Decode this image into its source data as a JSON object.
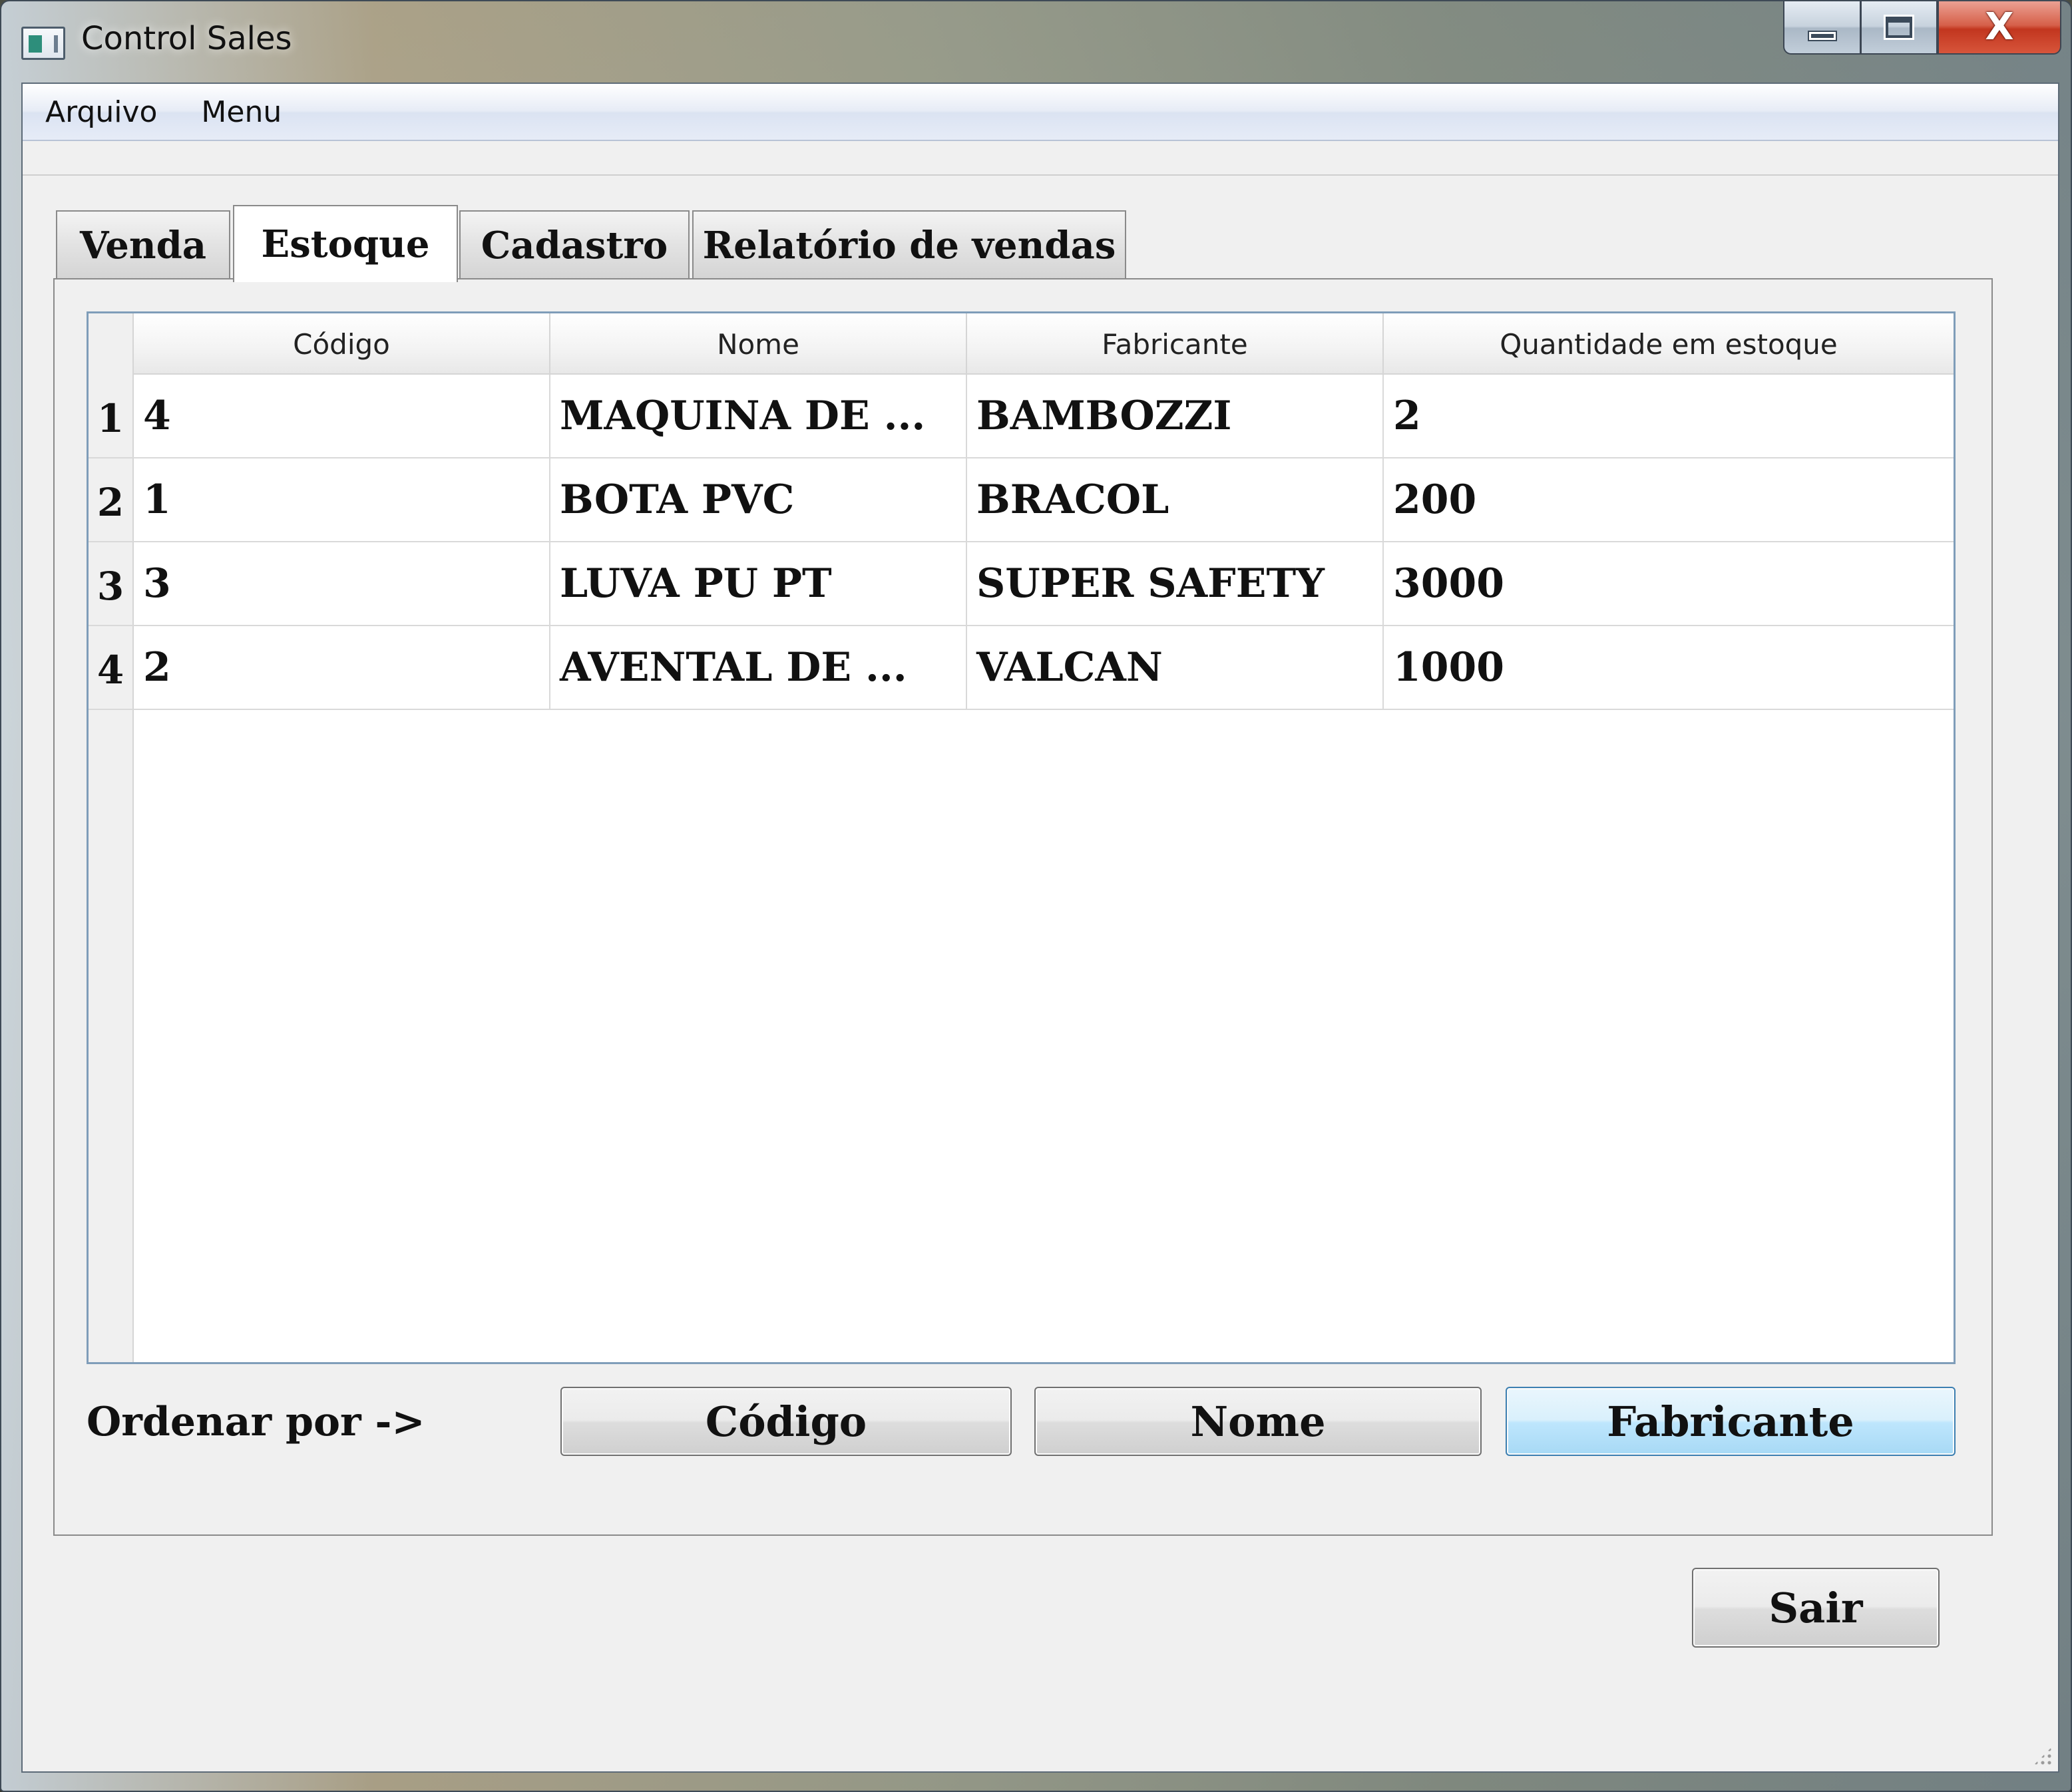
{
  "window": {
    "title": "Control Sales",
    "controls": {
      "minimize_icon": "minimize-icon",
      "maximize_icon": "restore-icon",
      "close_icon": "close-icon",
      "close_glyph": "X"
    }
  },
  "menubar": {
    "items": [
      {
        "label": "Arquivo"
      },
      {
        "label": "Menu"
      }
    ]
  },
  "tabs": [
    {
      "label": "Venda",
      "active": false
    },
    {
      "label": "Estoque",
      "active": true
    },
    {
      "label": "Cadastro",
      "active": false
    },
    {
      "label": "Relatório de vendas",
      "active": false
    }
  ],
  "grid": {
    "columns": [
      "Código",
      "Nome",
      "Fabricante",
      "Quantidade em estoque"
    ],
    "rows": [
      {
        "index": "1",
        "codigo": "4",
        "nome": "MAQUINA DE ...",
        "fabricante": "BAMBOZZI",
        "quantidade": "2"
      },
      {
        "index": "2",
        "codigo": "1",
        "nome": "BOTA PVC",
        "fabricante": "BRACOL",
        "quantidade": "200"
      },
      {
        "index": "3",
        "codigo": "3",
        "nome": "LUVA PU PT",
        "fabricante": "SUPER SAFETY",
        "quantidade": "3000"
      },
      {
        "index": "4",
        "codigo": "2",
        "nome": "AVENTAL DE ...",
        "fabricante": "VALCAN",
        "quantidade": "1000"
      }
    ]
  },
  "sort": {
    "label": "Ordenar por ->",
    "buttons": {
      "codigo": "Código",
      "nome": "Nome",
      "fabricante": "Fabricante"
    },
    "highlighted": "fabricante"
  },
  "footer": {
    "exit_label": "Sair"
  },
  "colors": {
    "client_background": "#f0f0f0",
    "grid_border": "#7f9db9",
    "hot_button": "#bee6fd",
    "close_button": "#c2361f"
  }
}
